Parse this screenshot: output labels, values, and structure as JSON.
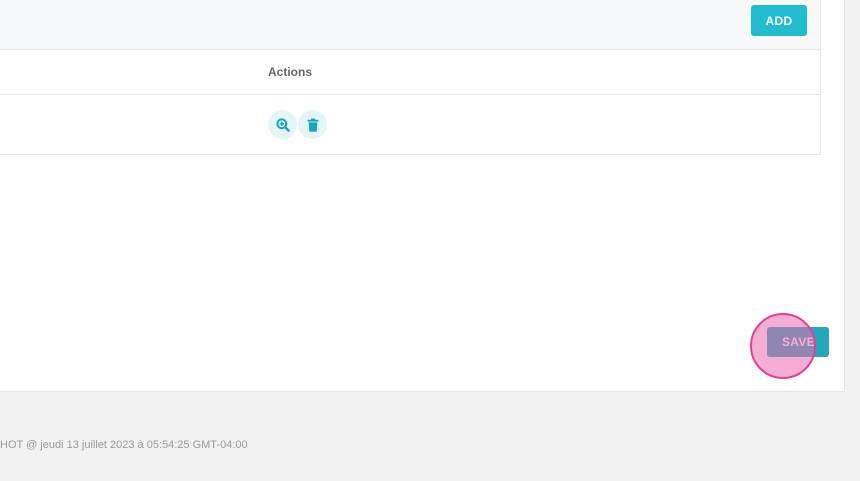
{
  "toolbar": {
    "add_label": "ADD"
  },
  "table": {
    "columns": [
      {
        "label": "Actions"
      }
    ],
    "rows": [
      {
        "actions": [
          {
            "icon": "zoom-in-icon"
          },
          {
            "icon": "trash-icon"
          }
        ]
      }
    ]
  },
  "form": {
    "save_label": "SAVE"
  },
  "footer": {
    "text": "HOT @ jeudi 13 juillet 2023 à 05:54:25 GMT-04:00"
  },
  "colors": {
    "accent": "#22bcd0",
    "save_button": "#22a7ba",
    "icon_button_bg": "#e3f5f7",
    "icon_color": "#1aa6b8",
    "click_marker": "#e0409a",
    "page_bg": "#f2f2f2"
  }
}
